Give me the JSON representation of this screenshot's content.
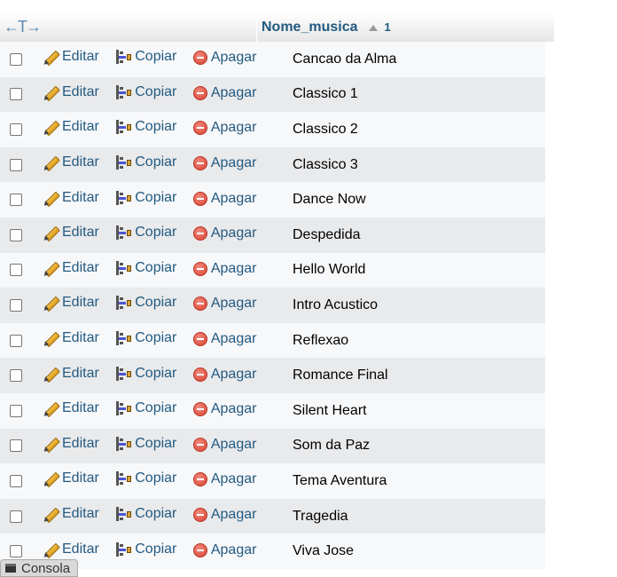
{
  "header": {
    "arrows_glyph": "←T→",
    "column_label": "Nome_musica",
    "sort_order": "1"
  },
  "actions": {
    "edit_label": "Editar",
    "copy_label": "Copiar",
    "delete_label": "Apagar"
  },
  "rows": [
    {
      "nome_musica": "Cancao da Alma"
    },
    {
      "nome_musica": "Classico 1"
    },
    {
      "nome_musica": "Classico 2"
    },
    {
      "nome_musica": "Classico 3"
    },
    {
      "nome_musica": "Dance Now"
    },
    {
      "nome_musica": "Despedida"
    },
    {
      "nome_musica": "Hello World"
    },
    {
      "nome_musica": "Intro Acustico"
    },
    {
      "nome_musica": "Reflexao"
    },
    {
      "nome_musica": "Romance Final"
    },
    {
      "nome_musica": "Silent Heart"
    },
    {
      "nome_musica": "Som da Paz"
    },
    {
      "nome_musica": "Tema Aventura"
    },
    {
      "nome_musica": "Tragedia"
    },
    {
      "nome_musica": "Viva Jose"
    }
  ],
  "console": {
    "label": "Consola"
  },
  "icons": {
    "edit": "pencil-icon",
    "copy": "copy-icon",
    "delete": "delete-icon",
    "console": "console-icon"
  },
  "colors": {
    "link": "#235a81",
    "row_odd": "#f7f8fa",
    "row_even": "#e9eaec"
  }
}
